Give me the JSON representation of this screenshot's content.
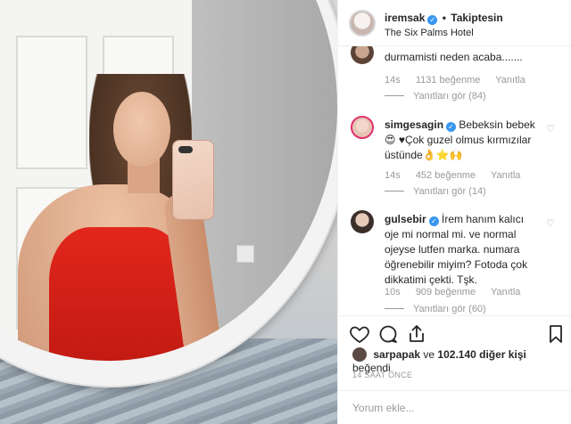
{
  "header": {
    "username": "iremsak",
    "separator": "•",
    "follow_status": "Takiptesin",
    "location": "The Six Palms Hotel"
  },
  "comments": [
    {
      "username": "",
      "text": "durmamisti neden acaba.......",
      "time": "14s",
      "likes": "1131 beğenme",
      "reply": "Yanıtla",
      "view_replies": "Yanıtları gör (84)"
    },
    {
      "username": "simgesagin",
      "text": "Bebeksin bebek😍 ♥Çok guzel olmus kırmızılar üstünde👌⭐🙌",
      "time": "14s",
      "likes": "452 beğenme",
      "reply": "Yanıtla",
      "view_replies": "Yanıtları gör (14)"
    },
    {
      "username": "gulsebir",
      "text": "İrem hanım kalıcı oje mi normal mi. ve normal ojeyse lutfen marka. numara öğrenebilir miyim? Fotoda çok dikkatimi çekti. Tşk.",
      "time": "10s",
      "likes": "909 beğenme",
      "reply": "Yanıtla",
      "view_replies": "Yanıtları gör (60)"
    }
  ],
  "likes": {
    "first_liker": "sarpapak",
    "middle": "ve",
    "others": "102.140 diğer kişi",
    "suffix": "beğendi"
  },
  "time_ago": "14 SAAT ÖNCE",
  "add_comment_placeholder": "Yorum ekle...",
  "icons": {
    "like": "heart-icon",
    "comment": "comment-icon",
    "share": "share-icon",
    "save": "bookmark-icon"
  },
  "colors": {
    "verified": "#3897f0",
    "muted_text": "#999999",
    "dress_red": "#e2271d"
  }
}
